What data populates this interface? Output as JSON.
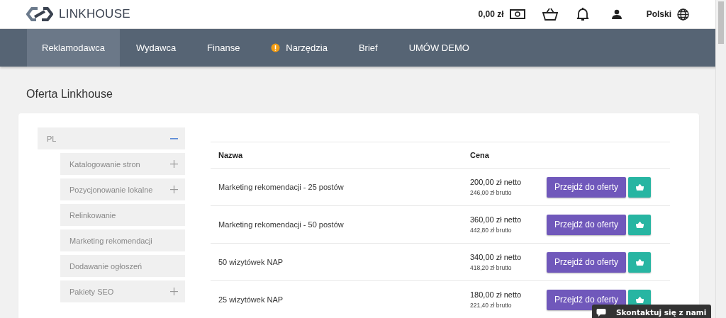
{
  "header": {
    "logo": "LINKHOUSE",
    "balance": "0,00 zł",
    "language": "Polski"
  },
  "nav": [
    {
      "label": "Reklamodawca",
      "selected": true,
      "alert": false
    },
    {
      "label": "Wydawca",
      "selected": false,
      "alert": false
    },
    {
      "label": "Finanse",
      "selected": false,
      "alert": false
    },
    {
      "label": "Narzędzia",
      "selected": false,
      "alert": true
    },
    {
      "label": "Brief",
      "selected": false,
      "alert": false
    },
    {
      "label": "UMÓW DEMO",
      "selected": false,
      "alert": false
    }
  ],
  "page_title": "Oferta Linkhouse",
  "sidebar": {
    "items": [
      {
        "label": "PL",
        "kind": "group",
        "expanded": true,
        "children": [
          {
            "label": "Katalogowanie stron",
            "kind": "group",
            "expanded": false
          },
          {
            "label": "Pozycjonowanie lokalne",
            "kind": "group",
            "expanded": false
          },
          {
            "label": "Relinkowanie",
            "kind": "leaf"
          },
          {
            "label": "Marketing rekomendacji",
            "kind": "leaf"
          },
          {
            "label": "Dodawanie ogłoszeń",
            "kind": "leaf"
          },
          {
            "label": "Pakiety SEO",
            "kind": "group",
            "expanded": false
          }
        ]
      }
    ]
  },
  "table": {
    "columns": [
      "Nazwa",
      "Cena"
    ],
    "rows": [
      {
        "name": "Marketing rekomendacji - 25 postów",
        "net": "200,00 zł netto",
        "gross": "246,00 zł brutto",
        "button": "Przejdź do oferty"
      },
      {
        "name": "Marketing rekomendacji - 50 postów",
        "net": "360,00 zł netto",
        "gross": "442,80 zł brutto",
        "button": "Przejdź do oferty"
      },
      {
        "name": "50 wizytówek NAP",
        "net": "340,00 zł netto",
        "gross": "418,20 zł brutto",
        "button": "Przejdź do oferty"
      },
      {
        "name": "25 wizytówek NAP",
        "net": "180,00 zł netto",
        "gross": "221,40 zł brutto",
        "button": "Przejdź do oferty"
      }
    ]
  },
  "chat": {
    "label": "Skontaktuj się z nami"
  }
}
